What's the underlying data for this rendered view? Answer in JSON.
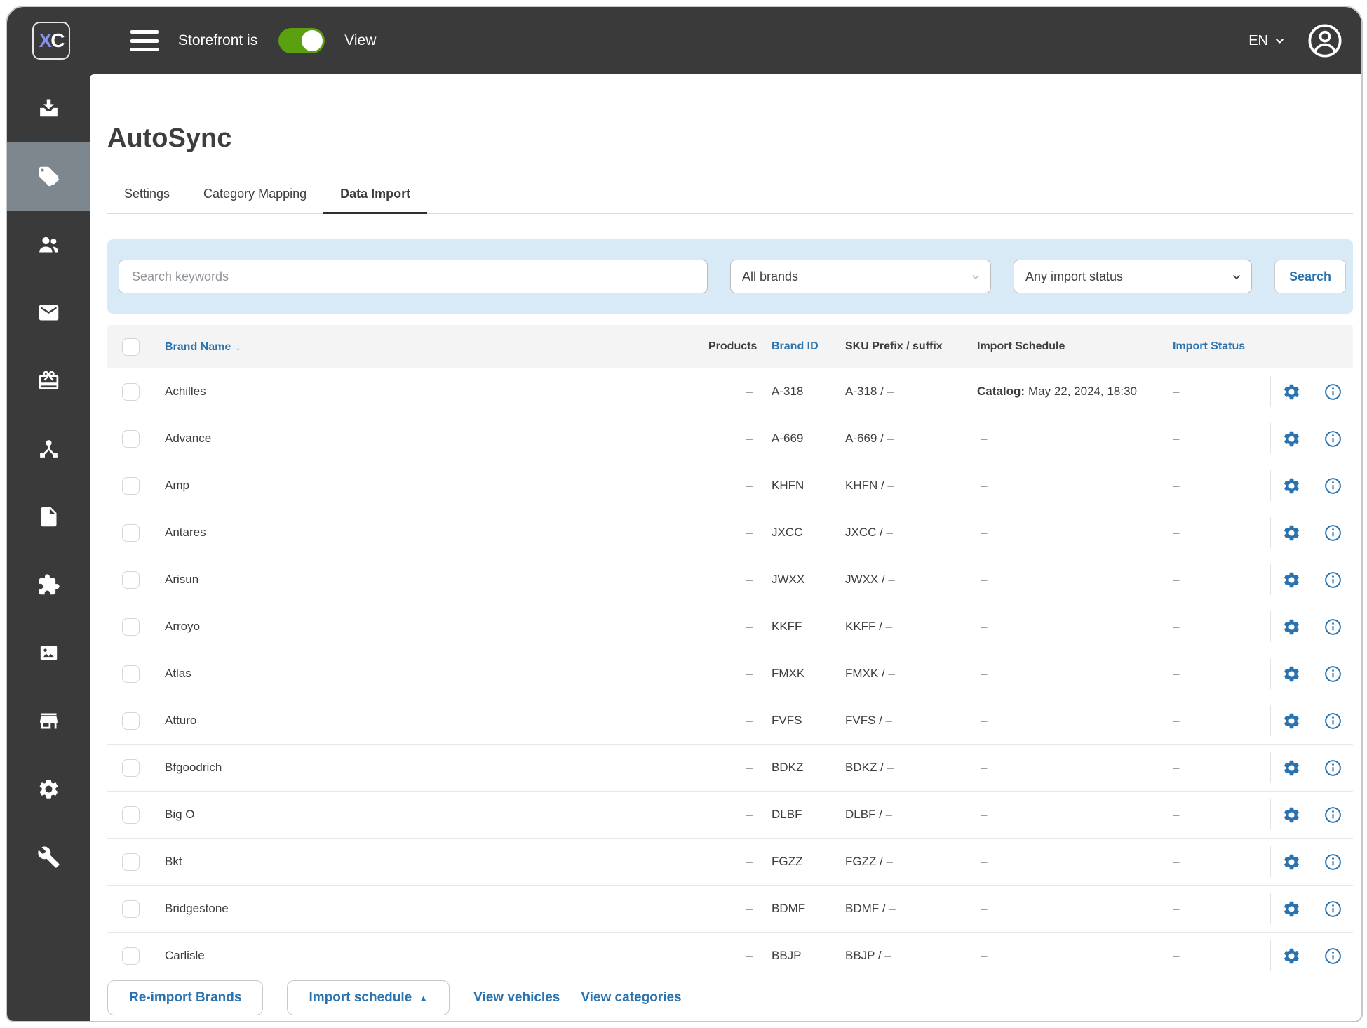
{
  "topbar": {
    "logo_x": "X",
    "logo_c": "C",
    "storefront_label": "Storefront is",
    "storefront_toggle_state": "on",
    "view_label": "View",
    "language": "EN"
  },
  "sidebar": {
    "icons": [
      "import-icon",
      "tags-icon",
      "users-icon",
      "mail-icon",
      "gift-icon",
      "share-nodes-icon",
      "file-icon",
      "puzzle-icon",
      "image-icon",
      "store-icon",
      "gear-icon",
      "wrench-icon"
    ],
    "active_icon": "tags-icon"
  },
  "page": {
    "title": "AutoSync"
  },
  "tabs": [
    {
      "label": "Settings",
      "active": false
    },
    {
      "label": "Category Mapping",
      "active": false
    },
    {
      "label": "Data Import",
      "active": true
    }
  ],
  "filters": {
    "search_placeholder": "Search keywords",
    "brand_filter_value": "All brands",
    "status_filter_value": "Any import status",
    "search_button": "Search"
  },
  "table": {
    "columns": [
      "Brand Name",
      "Products",
      "Brand ID",
      "SKU Prefix / suffix",
      "Import Schedule",
      "Import Status"
    ],
    "sort_column": "Brand Name",
    "sort_arrow": "↓",
    "rows": [
      {
        "name": "Achilles",
        "products": "–",
        "brand_id": "A-318",
        "sku": "A-318 / –",
        "schedule_label": "Catalog:",
        "schedule_value": "May 22, 2024, 18:30",
        "status": "–"
      },
      {
        "name": "Advance",
        "products": "–",
        "brand_id": "A-669",
        "sku": "A-669 / –",
        "schedule_label": "",
        "schedule_value": "–",
        "status": "–"
      },
      {
        "name": "Amp",
        "products": "–",
        "brand_id": "KHFN",
        "sku": "KHFN / –",
        "schedule_label": "",
        "schedule_value": "–",
        "status": "–"
      },
      {
        "name": "Antares",
        "products": "–",
        "brand_id": "JXCC",
        "sku": "JXCC / –",
        "schedule_label": "",
        "schedule_value": "–",
        "status": "–"
      },
      {
        "name": "Arisun",
        "products": "–",
        "brand_id": "JWXX",
        "sku": "JWXX / –",
        "schedule_label": "",
        "schedule_value": "–",
        "status": "–"
      },
      {
        "name": "Arroyo",
        "products": "–",
        "brand_id": "KKFF",
        "sku": "KKFF / –",
        "schedule_label": "",
        "schedule_value": "–",
        "status": "–"
      },
      {
        "name": "Atlas",
        "products": "–",
        "brand_id": "FMXK",
        "sku": "FMXK / –",
        "schedule_label": "",
        "schedule_value": "–",
        "status": "–"
      },
      {
        "name": "Atturo",
        "products": "–",
        "brand_id": "FVFS",
        "sku": "FVFS / –",
        "schedule_label": "",
        "schedule_value": "–",
        "status": "–"
      },
      {
        "name": "Bfgoodrich",
        "products": "–",
        "brand_id": "BDKZ",
        "sku": "BDKZ / –",
        "schedule_label": "",
        "schedule_value": "–",
        "status": "–"
      },
      {
        "name": "Big O",
        "products": "–",
        "brand_id": "DLBF",
        "sku": "DLBF / –",
        "schedule_label": "",
        "schedule_value": "–",
        "status": "–"
      },
      {
        "name": "Bkt",
        "products": "–",
        "brand_id": "FGZZ",
        "sku": "FGZZ / –",
        "schedule_label": "",
        "schedule_value": "–",
        "status": "–"
      },
      {
        "name": "Bridgestone",
        "products": "–",
        "brand_id": "BDMF",
        "sku": "BDMF / –",
        "schedule_label": "",
        "schedule_value": "–",
        "status": "–"
      },
      {
        "name": "Carlisle",
        "products": "–",
        "brand_id": "BBJP",
        "sku": "BBJP / –",
        "schedule_label": "",
        "schedule_value": "–",
        "status": "–"
      }
    ]
  },
  "footer": {
    "reimport_button": "Re-import Brands",
    "schedule_button": "Import schedule",
    "schedule_caret": "▲",
    "links": [
      "View vehicles",
      "View categories"
    ]
  },
  "colors": {
    "accent_blue": "#2a73ae",
    "toggle_green": "#5ba00f",
    "topbar_dark": "#3a3a3a",
    "sidebar_active": "#7e868e",
    "filter_bg": "#d9eaf7"
  }
}
